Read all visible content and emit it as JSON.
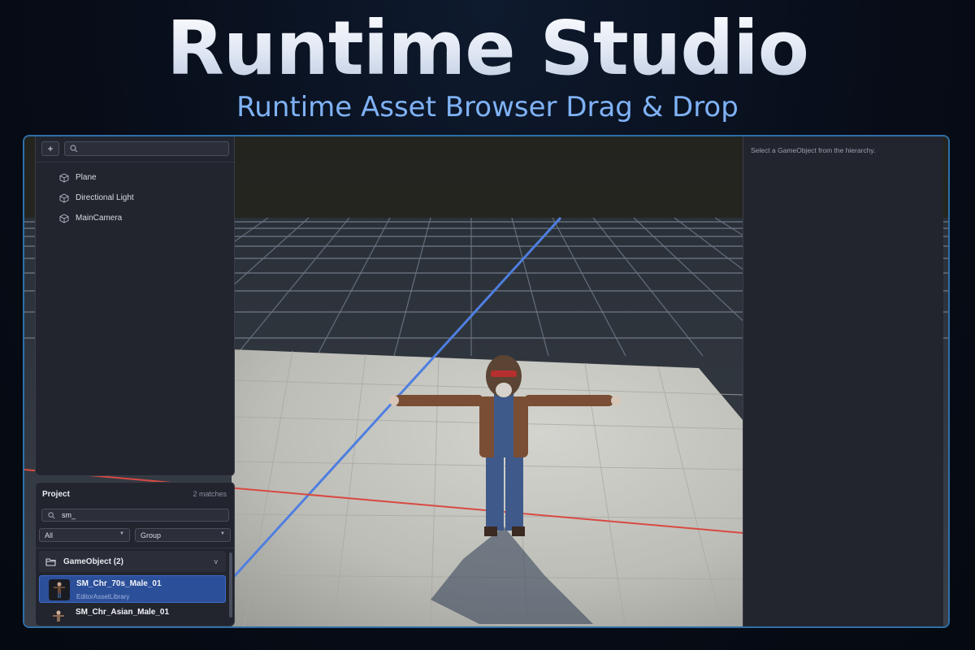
{
  "hero": {
    "title": "Runtime Studio",
    "subtitle": "Runtime Asset Browser Drag & Drop"
  },
  "hierarchy": {
    "add_label": "+",
    "search_placeholder": "",
    "items": [
      {
        "label": "Plane",
        "icon": "cube-icon"
      },
      {
        "label": "Directional Light",
        "icon": "cube-icon"
      },
      {
        "label": "MainCamera",
        "icon": "cube-icon"
      }
    ]
  },
  "project": {
    "title": "Project",
    "match_count": "2 matches",
    "search_value": "sm_",
    "filter_type": "All",
    "grouping": "Group",
    "group": {
      "label": "GameObject (2)",
      "chevron": "v",
      "icon": "folder-icon"
    },
    "assets": [
      {
        "name": "SM_Chr_70s_Male_01",
        "source": "EditorAssetLibrary",
        "selected": true
      },
      {
        "name": "SM_Chr_Asian_Male_01",
        "source": "",
        "selected": false
      }
    ]
  },
  "inspector": {
    "empty_message": "Select a GameObject from the hierarchy."
  },
  "colors": {
    "accent": "#7fb2f5",
    "frame_border": "#2e6fa8",
    "selection": "#2c4f9a",
    "z_axis": "#4f7fe0",
    "x_axis": "#d84a42"
  }
}
